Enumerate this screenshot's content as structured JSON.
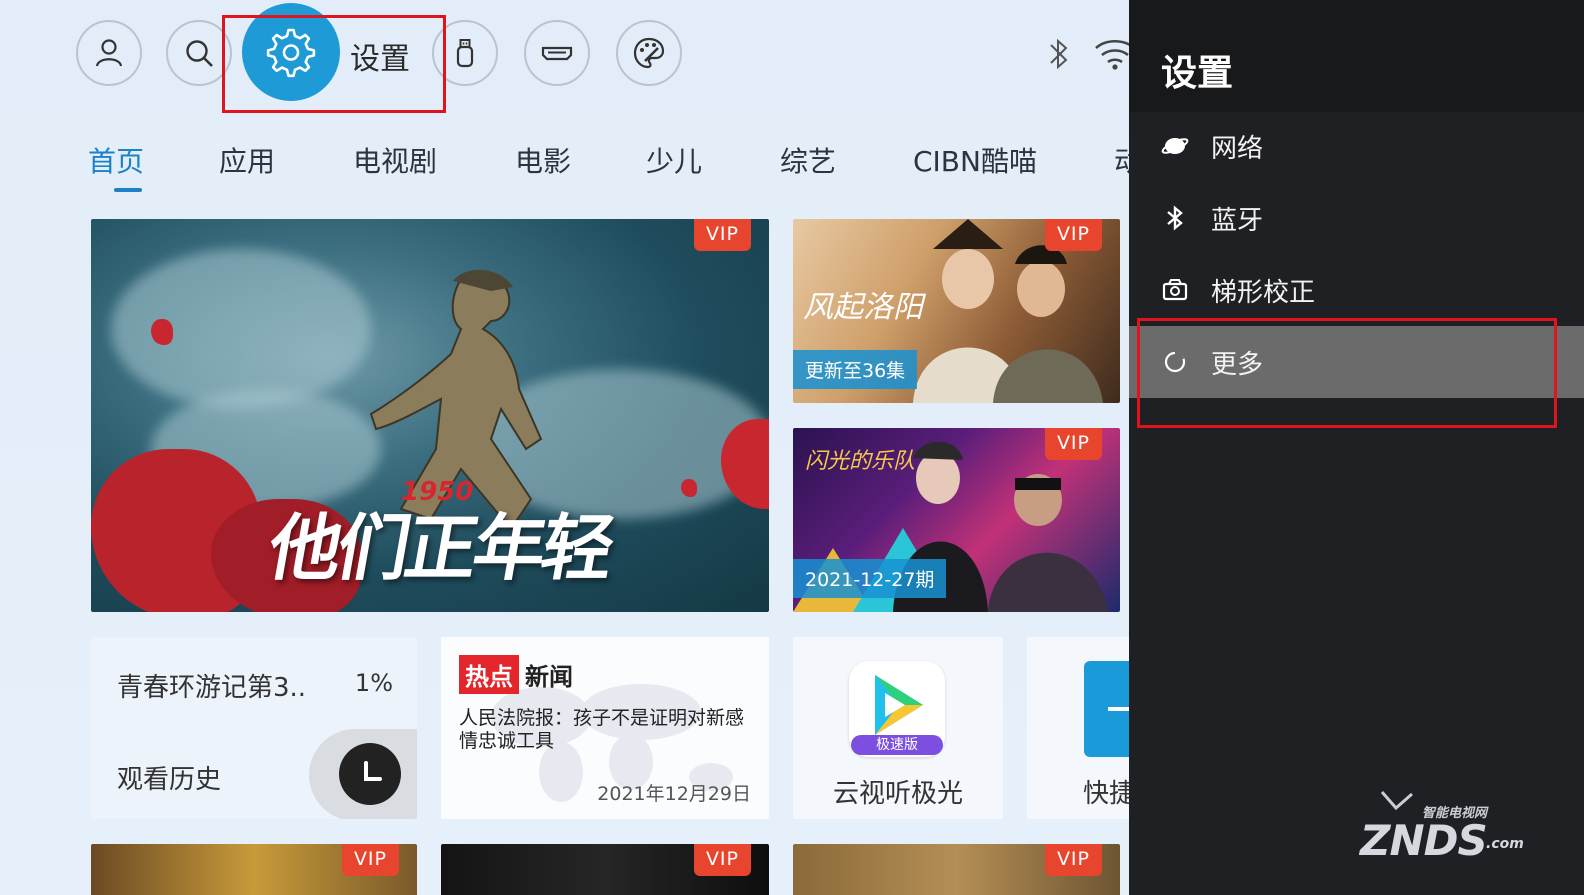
{
  "topbar": {
    "settings_label": "设置"
  },
  "tabs": [
    "首页",
    "应用",
    "电视剧",
    "电影",
    "少儿",
    "综艺",
    "CIBN酷喵",
    "动"
  ],
  "cards": {
    "hero": {
      "vip": "VIP",
      "year": "1950",
      "title": "他们正年轻"
    },
    "top_right": {
      "vip": "VIP",
      "tag": "更新至36集"
    },
    "mid_right": {
      "vip": "VIP",
      "tag": "2021-12-27期"
    },
    "history": {
      "title": "青春环游记第3..",
      "percent": "1%",
      "label": "观看历史"
    },
    "news": {
      "hot": "热点",
      "label": "新闻",
      "text": "人民法院报：孩子不是证明对新感情忠诚工具",
      "date": "2021年12月29日"
    },
    "app1": {
      "name": "云视听极光",
      "badge": "极速版"
    },
    "app2": {
      "name": "快捷"
    },
    "bottom": [
      {
        "vip": "VIP"
      },
      {
        "vip": "VIP"
      },
      {
        "vip": "VIP"
      }
    ]
  },
  "panel": {
    "title": "设置",
    "items": [
      {
        "label": "网络",
        "icon": "network-icon"
      },
      {
        "label": "蓝牙",
        "icon": "bluetooth-icon"
      },
      {
        "label": "梯形校正",
        "icon": "keystone-icon"
      },
      {
        "label": "更多",
        "icon": "more-icon"
      }
    ]
  },
  "watermark": {
    "small": "智能电视网",
    "big": "ZNDS",
    "suffix": ".com"
  },
  "colors": {
    "accent": "#1e9ad7",
    "highlight_box": "#e0141c",
    "vip": "#e8452f",
    "panel_bg": "#1f2023"
  }
}
